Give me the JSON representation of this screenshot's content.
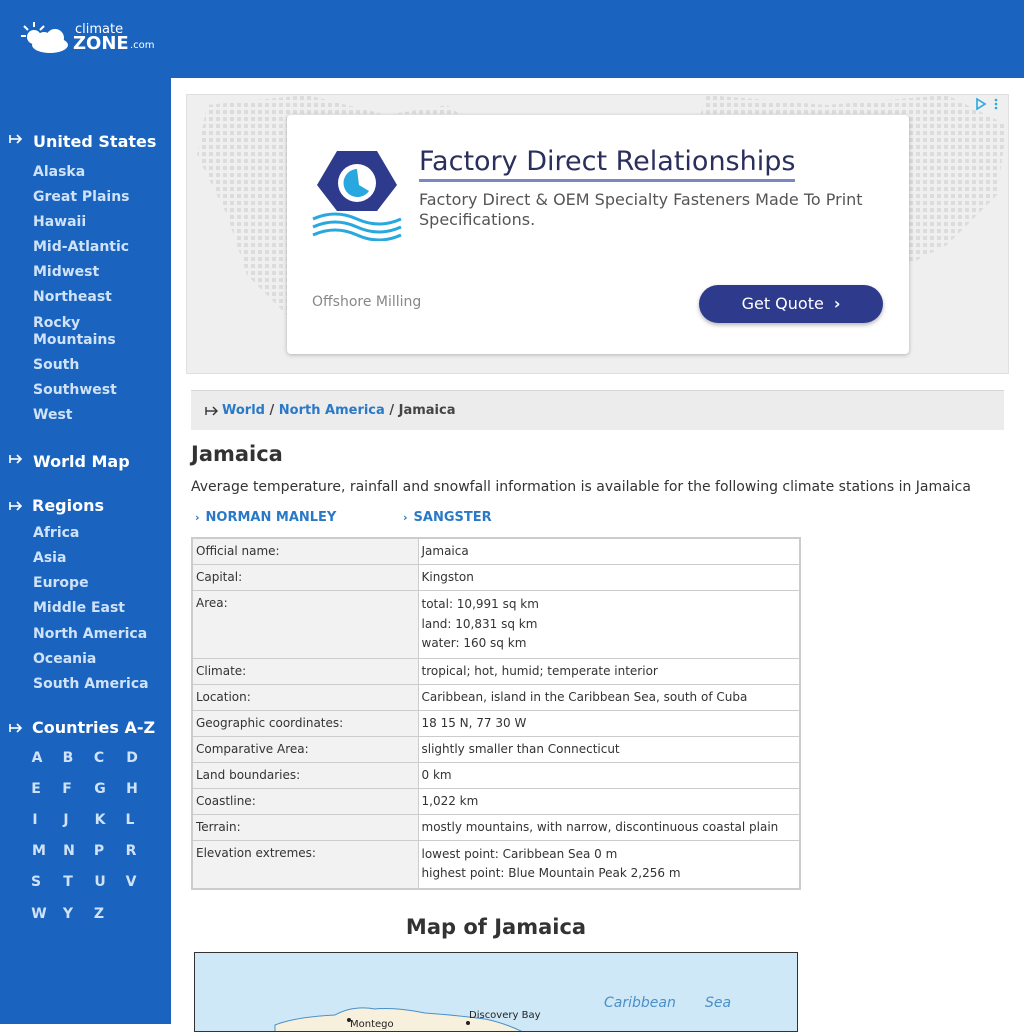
{
  "header": {
    "logo_small": "climate",
    "logo_big": "ZONE",
    "logo_com": ".com"
  },
  "sidebar": {
    "united_states": {
      "title": "United States",
      "items": [
        "Alaska",
        "Great Plains",
        "Hawaii",
        "Mid-Atlantic",
        "Midwest",
        "Northeast",
        "Rocky Mountains",
        "South",
        "Southwest",
        "West"
      ]
    },
    "world_map": {
      "title": "World Map"
    },
    "regions": {
      "title": "Regions",
      "items": [
        "Africa",
        "Asia",
        "Europe",
        "Middle East",
        "North America",
        "Oceania",
        "South America"
      ]
    },
    "countries": {
      "title": "Countries A-Z",
      "letters": [
        "A",
        "B",
        "C",
        "D",
        "E",
        "F",
        "G",
        "H",
        "I",
        "J",
        "K",
        "L",
        "M",
        "N",
        "P",
        "R",
        "S",
        "T",
        "U",
        "V",
        "W",
        "Y",
        "Z"
      ]
    }
  },
  "ad": {
    "title": "Factory Direct Relationships",
    "description": "Factory Direct & OEM Specialty Fasteners Made To Print Specifications.",
    "advertiser": "Offshore Milling",
    "cta": "Get Quote",
    "cta_chevron": "›",
    "colors": {
      "button": "#2e3a8c",
      "logo_blue": "#2e3a8c",
      "logo_cyan": "#29a8e0"
    }
  },
  "breadcrumb": {
    "world": "World",
    "sep1": " / ",
    "north_america": "North America",
    "sep2": " / ",
    "current": "Jamaica"
  },
  "main": {
    "title": "Jamaica",
    "intro": "Average temperature, rainfall and snowfall information is available for the following climate stations in Jamaica",
    "stations": [
      "NORMAN MANLEY",
      "SANGSTER"
    ],
    "station_chevron": "›"
  },
  "facts": [
    {
      "key": "Official name:",
      "value": [
        "Jamaica"
      ]
    },
    {
      "key": "Capital:",
      "value": [
        "Kingston"
      ]
    },
    {
      "key": "Area:",
      "value": [
        "total: 10,991 sq km",
        "land: 10,831 sq km",
        "water: 160 sq km"
      ]
    },
    {
      "key": "Climate:",
      "value": [
        "tropical; hot, humid; temperate interior"
      ]
    },
    {
      "key": "Location:",
      "value": [
        "Caribbean, island in the Caribbean Sea, south of Cuba"
      ]
    },
    {
      "key": "Geographic coordinates:",
      "value": [
        "18 15 N, 77 30 W"
      ]
    },
    {
      "key": "Comparative Area:",
      "value": [
        "slightly smaller than Connecticut"
      ]
    },
    {
      "key": "Land boundaries:",
      "value": [
        "0 km"
      ]
    },
    {
      "key": "Coastline:",
      "value": [
        "1,022 km"
      ]
    },
    {
      "key": "Terrain:",
      "value": [
        "mostly mountains, with narrow, discontinuous coastal plain"
      ]
    },
    {
      "key": "Elevation extremes:",
      "value": [
        "lowest point: Caribbean Sea 0 m",
        "highest point: Blue Mountain Peak 2,256 m"
      ]
    }
  ],
  "map": {
    "title": "Map of Jamaica",
    "sea_label_1": "Caribbean",
    "sea_label_2": "Sea",
    "town_1": "Discovery Bay",
    "town_2": "Montego",
    "colors": {
      "sea": "#cfe8f7",
      "land": "#f7f0dc"
    }
  }
}
